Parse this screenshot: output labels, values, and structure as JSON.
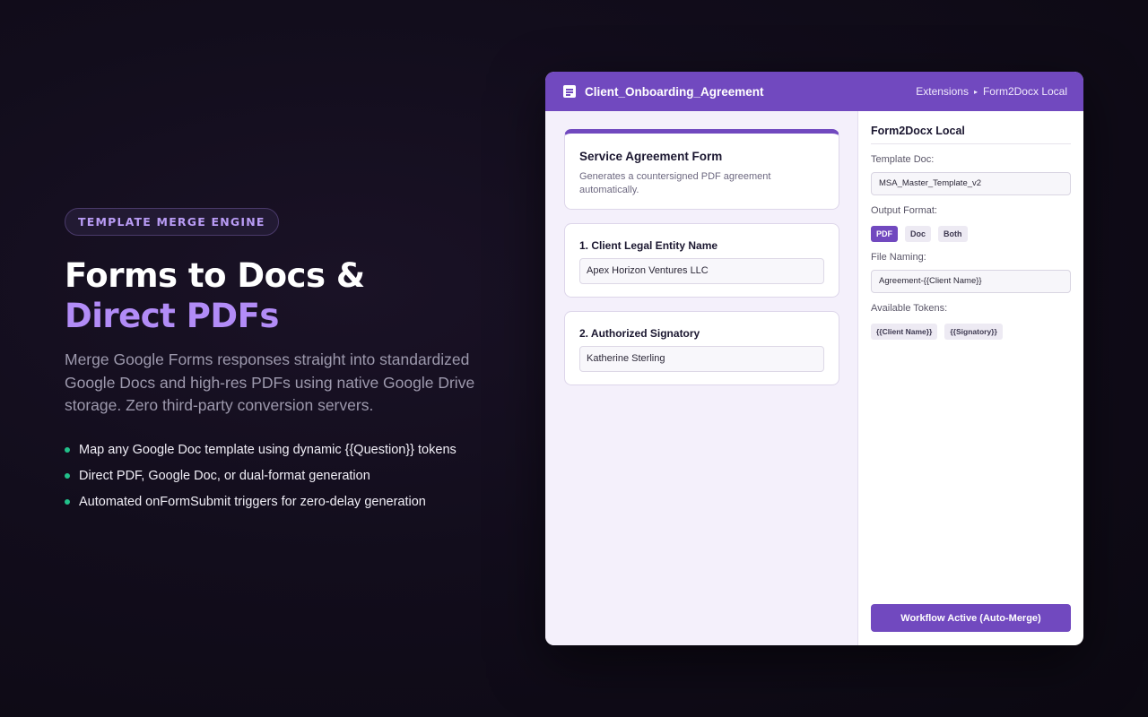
{
  "hero": {
    "badge": "TEMPLATE MERGE ENGINE",
    "headline_part1": "Forms to Docs & ",
    "headline_accent": "Direct PDFs",
    "lead": "Merge Google Forms responses straight into standardized Google Docs and high-res PDFs using native Google Drive storage. Zero third-party conversion servers.",
    "bullets": [
      "Map any Google Doc template using dynamic {{Question}} tokens",
      "Direct PDF, Google Doc, or dual-format generation",
      "Automated onFormSubmit triggers for zero-delay generation"
    ]
  },
  "window": {
    "title": "Client_Onboarding_Agreement",
    "breadcrumb": [
      "Extensions",
      "Form2Docx Local"
    ],
    "breadcrumb_separator": "▸",
    "form": {
      "title": "Service Agreement Form",
      "description": "Generates a countersigned PDF agreement automatically.",
      "questions": [
        {
          "label": "1. Client Legal Entity Name",
          "value": "Apex Horizon Ventures LLC"
        },
        {
          "label": "2. Authorized Signatory",
          "value": "Katherine Sterling"
        }
      ]
    },
    "sidebar": {
      "title": "Form2Docx Local",
      "template_label": "Template Doc:",
      "template_value": "MSA_Master_Template_v2",
      "format_label": "Output Format:",
      "formats": [
        "PDF",
        "Doc",
        "Both"
      ],
      "selected_format": "PDF",
      "naming_label": "File Naming:",
      "naming_value": "Agreement-{{Client Name}}",
      "tokens_label": "Available Tokens:",
      "tokens": [
        "{{Client Name}}",
        "{{Signatory}}"
      ],
      "workflow_button": "Workflow Active (Auto-Merge)"
    }
  },
  "colors": {
    "accent": "#7149bf",
    "accent_light": "#b28cf7",
    "bullet": "#22c08a",
    "background": "#120d1c"
  },
  "icons": {
    "doc": "document-icon",
    "bullet": "bullet-dot-icon"
  }
}
